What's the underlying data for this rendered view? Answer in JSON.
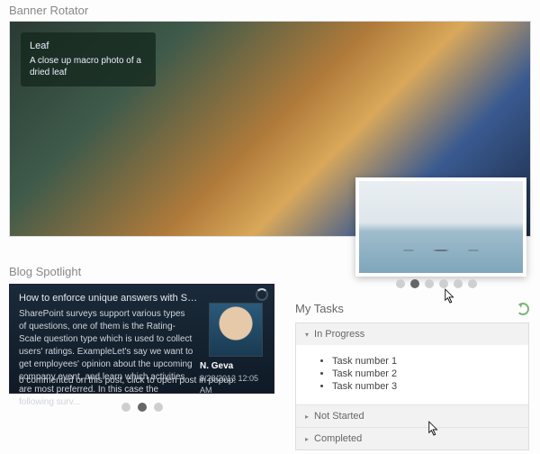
{
  "banner": {
    "section_title": "Banner Rotator",
    "overlay_title": "Leaf",
    "overlay_desc": "A close up macro photo of a dried leaf",
    "active_dot_index": 1,
    "dot_count": 6
  },
  "blog": {
    "section_title": "Blog Spotlight",
    "headline": "How to enforce unique answers with Sh...",
    "body": "SharePoint surveys support various types of questions, one of them is the Rating-Scale question type which is used to collect users' ratings. ExampleLet's say we want to get employees' opinion about the upcoming company event, and learn which activities are most preferred. In this case the following surv...",
    "footer": "0 commented on this post, click to open post in popup.",
    "author_name": "N. Geva",
    "author_date": "8/28/2013 12:05 AM",
    "active_dot_index": 1,
    "dot_count": 3
  },
  "tasks": {
    "section_title": "My Tasks",
    "sections": [
      {
        "label": "In Progress",
        "expanded": true,
        "items": [
          "Task number 1",
          "Task number 2",
          "Task number 3"
        ]
      },
      {
        "label": "Not Started",
        "expanded": false
      },
      {
        "label": "Completed",
        "expanded": false
      }
    ]
  }
}
